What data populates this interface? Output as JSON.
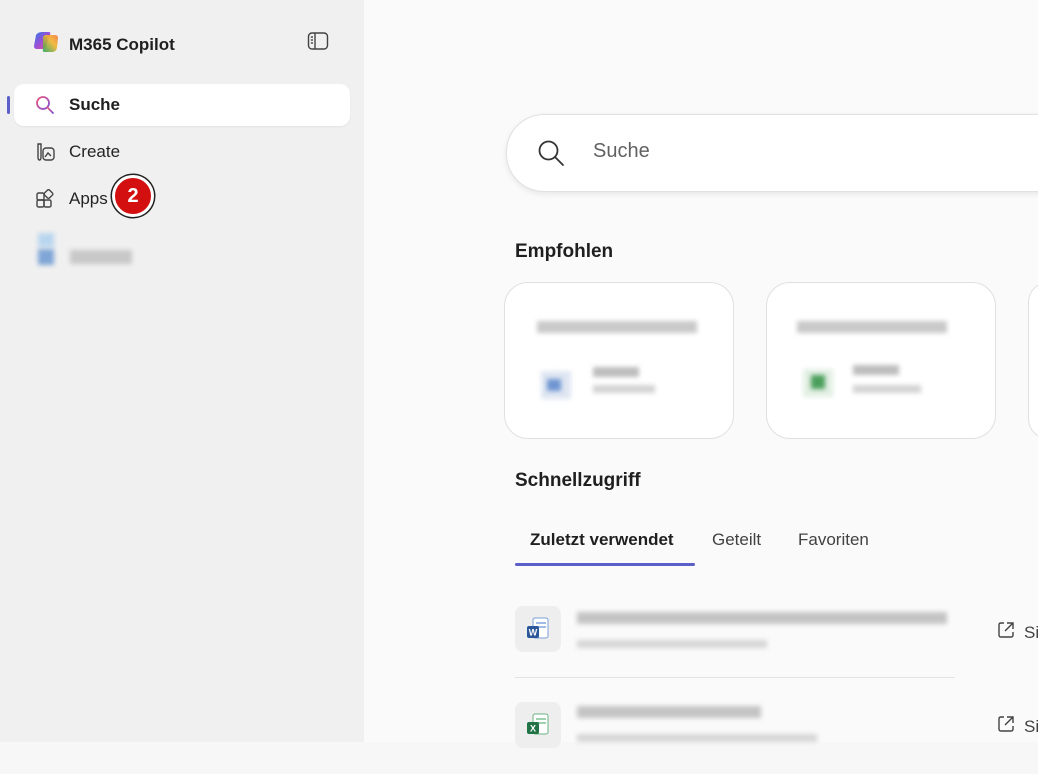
{
  "app": {
    "title": "M365 Copilot"
  },
  "nav": {
    "items": [
      {
        "label": "Suche",
        "icon": "search-icon",
        "active": true
      },
      {
        "label": "Create",
        "icon": "create-icon",
        "active": false
      },
      {
        "label": "Apps",
        "icon": "apps-icon",
        "active": false
      }
    ]
  },
  "badge": {
    "number": "2"
  },
  "search": {
    "placeholder": "Suche"
  },
  "recommended": {
    "title": "Empfohlen"
  },
  "quick_access": {
    "title": "Schnellzugriff",
    "tabs": [
      {
        "label": "Zuletzt verwendet",
        "active": true
      },
      {
        "label": "Geteilt",
        "active": false
      },
      {
        "label": "Favoriten",
        "active": false
      }
    ],
    "row_action_label": "Si"
  },
  "colors": {
    "accent": "#5b5fc7",
    "badge": "#d40f0f",
    "word": "#2b579a",
    "excel": "#217346"
  }
}
